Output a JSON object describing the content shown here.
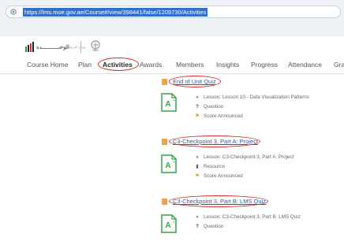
{
  "browser": {
    "url": "https://lms.moe.gov.ae/Course#/view/398441/false/1209730/Activities"
  },
  "brand": {
    "org_text": "الوحـــــــــــدة",
    "small_text": "وزارة التربية والتعليم"
  },
  "nav": {
    "items": [
      {
        "label": "Course Home"
      },
      {
        "label": "Plan"
      },
      {
        "label": "Activities"
      },
      {
        "label": "Awards"
      },
      {
        "label": "Members"
      },
      {
        "label": "Insights"
      },
      {
        "label": "Progress"
      },
      {
        "label": "Attendance"
      },
      {
        "label": "Gra"
      }
    ]
  },
  "activities": [
    {
      "title": "End of Unit Quiz",
      "lesson": "Lesson: Lesson 10 - Data Visualization Patterns",
      "type": "Question",
      "status": "Score Announced"
    },
    {
      "title": "C3-Checkpoint 3, Part A: Project",
      "lesson": "Lesson: C3-Checkpoint 3, Part A: Project",
      "type": "Resource",
      "status": "Score Announced"
    },
    {
      "title": "C3-Checkpoint 3, Part B: LMS Quiz",
      "lesson": "Lesson: C3-Checkpoint 3, Part B: LMS Quiz",
      "type": "Question"
    }
  ],
  "colors": {
    "annotation_red": "#d0302b",
    "link_blue": "#2a58b0",
    "icon_green": "#37a24a"
  }
}
